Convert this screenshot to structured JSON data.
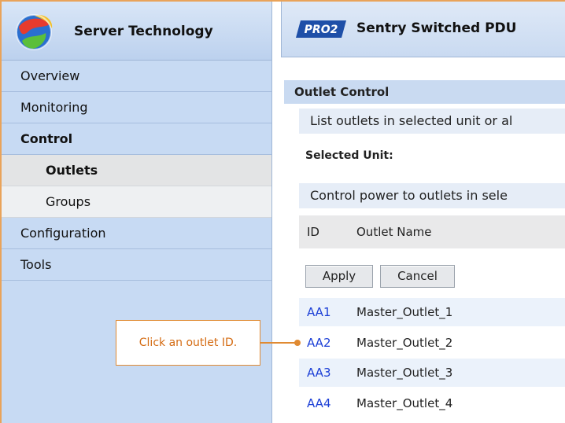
{
  "brand": {
    "name": "Server Technology",
    "logo_icon": "globe-logo-icon"
  },
  "header": {
    "badge": "PRO2",
    "product": "Sentry Switched PDU"
  },
  "sidebar": {
    "items": [
      {
        "label": "Overview"
      },
      {
        "label": "Monitoring"
      },
      {
        "label": "Control"
      },
      {
        "label": "Outlets"
      },
      {
        "label": "Groups"
      },
      {
        "label": "Configuration"
      },
      {
        "label": "Tools"
      }
    ]
  },
  "main": {
    "section_title": "Outlet Control",
    "list_text": "List outlets in selected unit or al",
    "selected_unit_label": "Selected Unit:",
    "control_text": "Control power to outlets in sele",
    "columns": [
      "ID",
      "Outlet Name"
    ],
    "apply_label": "Apply",
    "cancel_label": "Cancel",
    "outlets": [
      {
        "id": "AA1",
        "name": "Master_Outlet_1"
      },
      {
        "id": "AA2",
        "name": "Master_Outlet_2"
      },
      {
        "id": "AA3",
        "name": "Master_Outlet_3"
      },
      {
        "id": "AA4",
        "name": "Master_Outlet_4"
      }
    ]
  },
  "callout": {
    "text": "Click an outlet ID."
  },
  "colors": {
    "accent": "#e08a32",
    "link": "#1c3fd6",
    "sidebar": "#c7daf3"
  }
}
